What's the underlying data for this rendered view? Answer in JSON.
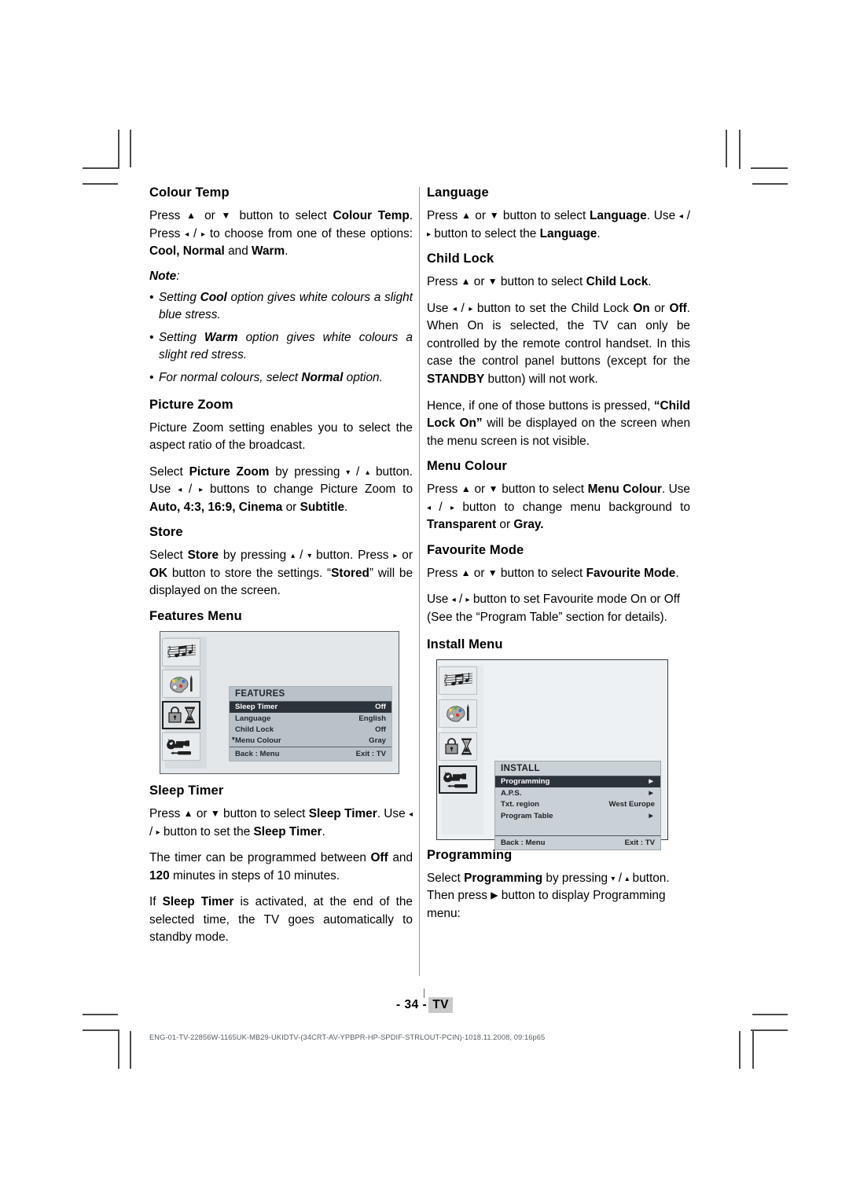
{
  "document": {
    "page_number": "- 34 -",
    "page_tag": "TV",
    "file_path": "ENG-01-TV-22856W-1165UK-MB29-UKIDTV-(34CRT-AV-YPBPR-HP-SPDIF-STRLOUT-PCIN)-10"
  },
  "footer": {
    "datestamp": "18.11.2008, 09:16",
    "filetype": "p65"
  },
  "left_column": {
    "colour_temp": {
      "heading": "Colour Temp",
      "para_1_a": "Press ",
      "para_1_b": " or ",
      "para_1_c": " button to select ",
      "para_1_bold": "Colour Temp",
      "para_1_d": ". Press ",
      "para_1_e": " / ",
      "para_1_f": " to choose from one of these options: ",
      "para_1_opt1": "Cool,",
      "para_1_opt2": "Normal",
      "para_1_and": " and ",
      "para_1_opt3": "Warm",
      "para_1_end": ".",
      "note_label": "Note",
      "note_colon": ":",
      "notes": [
        {
          "pre": "Setting ",
          "bold": "Cool",
          "post": " option gives white colours a slight blue stress."
        },
        {
          "pre": "Setting ",
          "bold": "Warm",
          "post": " option gives white colours a slight red stress."
        },
        {
          "pre": "For normal colours, select ",
          "bold": "Normal",
          "post": " option."
        }
      ]
    },
    "picture_zoom": {
      "heading": "Picture Zoom",
      "para_1": "Picture Zoom setting enables you to select the aspect ratio of the broadcast.",
      "para_2_a": "Select ",
      "para_2_bold": "Picture Zoom",
      "para_2_b": " by pressing ",
      "para_2_c": " / ",
      "para_2_d": " button. Use ",
      "para_2_e": " / ",
      "para_2_f": " buttons to change Picture Zoom to ",
      "para_2_opts": "Auto, 4:3, 16:9, Cinema",
      "para_2_or": " or ",
      "para_2_opt_last": "Subtitle",
      "para_2_end": "."
    },
    "store": {
      "heading": "Store",
      "para_a": "Select ",
      "para_bold": "Store",
      "para_b": " by pressing ",
      "para_c": " / ",
      "para_d": " button. Press ",
      "para_e": " or ",
      "para_ok": "OK",
      "para_f": " button to store the settings. “",
      "para_stored": "Stored",
      "para_g": "” will be displayed on the screen."
    },
    "features_menu": {
      "heading": "Features Menu"
    },
    "sleep_timer": {
      "heading": "Sleep Timer",
      "para_1_a": "Press ",
      "para_1_b": " or ",
      "para_1_c": " button to select ",
      "para_1_bold": "Sleep Timer",
      "para_1_d": ". Use ",
      "para_1_e": " / ",
      "para_1_f": " button to set the ",
      "para_1_bold2": "Sleep Timer",
      "para_1_end": ".",
      "para_2_a": "The timer can be programmed between ",
      "para_2_off": "Off",
      "para_2_b": " and ",
      "para_2_num": "120",
      "para_2_c": " minutes in steps of 10 minutes.",
      "para_3_a": "If ",
      "para_3_bold": "Sleep Timer",
      "para_3_b": " is activated, at the end of the selected time, the TV goes automatically to standby mode."
    }
  },
  "right_column": {
    "language": {
      "heading": "Language",
      "para_a": "Press ",
      "para_b": " or ",
      "para_c": " button to select ",
      "para_bold": "Language",
      "para_d": ". Use ",
      "para_e": " / ",
      "para_f": " button to select the ",
      "para_bold2": "Language",
      "para_end": "."
    },
    "child_lock": {
      "heading": "Child Lock",
      "para_1_a": "Press ",
      "para_1_b": " or ",
      "para_1_c": " button to select ",
      "para_1_bold": "Child Lock",
      "para_1_end": ".",
      "para_2_a": "Use ",
      "para_2_b": " / ",
      "para_2_c": " button  to set the Child Lock ",
      "para_2_on": "On",
      "para_2_or": " or ",
      "para_2_off": "Off",
      "para_2_d": ". When On is selected, the TV can only be controlled by the remote control handset. In this case the control panel buttons (except for the ",
      "para_2_standby": "STANDBY",
      "para_2_e": " button) will not work.",
      "para_3_a": "Hence, if one of those buttons is pressed, ",
      "para_3_quote": "“Child Lock On”",
      "para_3_b": " will be displayed on the screen when the menu screen is not visible."
    },
    "menu_colour": {
      "heading": "Menu Colour",
      "para_a": "Press ",
      "para_b": " or ",
      "para_c": " button to select ",
      "para_bold": "Menu Colour",
      "para_d": ". Use ",
      "para_e": " / ",
      "para_f": " button to change menu background to ",
      "para_transparent": "Transparent",
      "para_or": " or ",
      "para_gray": "Gray."
    },
    "favourite_mode": {
      "heading": "Favourite Mode",
      "para_1_a": "Press ",
      "para_1_b": " or ",
      "para_1_c": " button to select ",
      "para_1_bold": "Favourite Mode",
      "para_1_end": ".",
      "para_2_a": "Use ",
      "para_2_b": " / ",
      "para_2_c": " button to set Favourite mode On or Off (See the “Program Table” section for details)."
    },
    "install_menu": {
      "heading": "Install Menu"
    },
    "programming": {
      "heading": "Programming",
      "para_a": "Select ",
      "para_bold": "Programming",
      "para_b": " by pressing ",
      "para_c": " / ",
      "para_d": " button. Then press ",
      "para_e": " button to display Programming menu:"
    }
  },
  "osd_features": {
    "title": "FEATURES",
    "rows": [
      {
        "label": "Sleep Timer",
        "value": "Off",
        "highlighted": true
      },
      {
        "label": "Language",
        "value": "English",
        "highlighted": false
      },
      {
        "label": "Child Lock",
        "value": "Off",
        "highlighted": false
      },
      {
        "label": "Menu Colour",
        "value": "Gray",
        "highlighted": false
      }
    ],
    "footer_left": "Back : Menu",
    "footer_right": "Exit : TV",
    "icons": [
      "sound-notes-icon",
      "picture-palette-icon",
      "features-lock-hourglass-icon",
      "install-tools-icon"
    ],
    "selected_icon_index": 2
  },
  "osd_install": {
    "title": "INSTALL",
    "rows": [
      {
        "label": "Programming",
        "value": "►",
        "highlighted": true
      },
      {
        "label": "A.P.S.",
        "value": "►",
        "highlighted": false
      },
      {
        "label": "Txt. region",
        "value": "West Europe",
        "highlighted": false
      },
      {
        "label": "Program Table",
        "value": "►",
        "highlighted": false
      }
    ],
    "footer_left": "Back : Menu",
    "footer_right": "Exit : TV",
    "icons": [
      "sound-notes-icon",
      "picture-palette-icon",
      "features-lock-hourglass-icon",
      "install-tools-icon"
    ],
    "selected_icon_index": 3
  },
  "glyphs": {
    "up": "▲",
    "down": "▼",
    "left": "◀",
    "right": "▶",
    "up_small": "▴",
    "down_small": "▾",
    "left_small": "◂",
    "right_small": "▸"
  }
}
